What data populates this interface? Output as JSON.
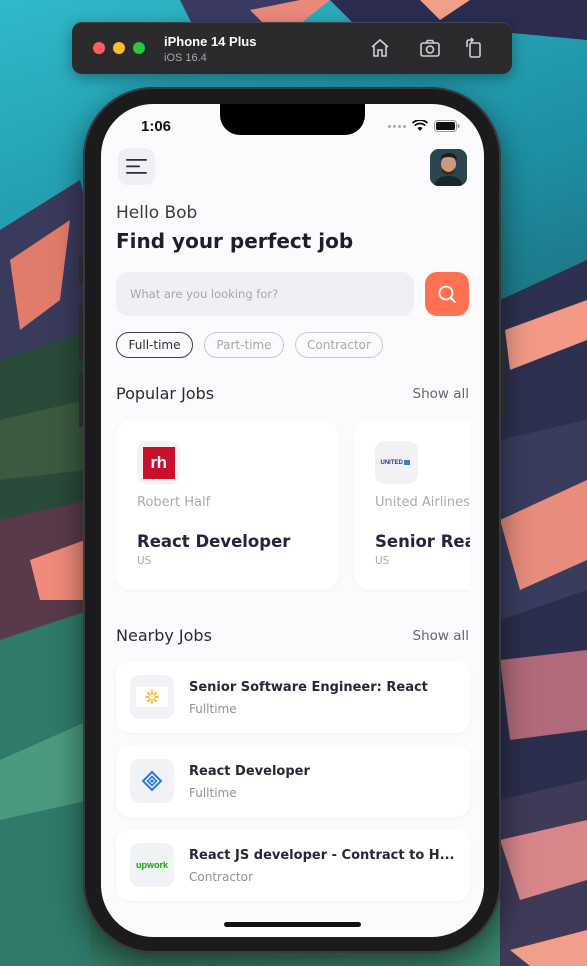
{
  "simulator": {
    "device": "iPhone 14 Plus",
    "os": "iOS 16.4"
  },
  "status_bar": {
    "time": "1:06"
  },
  "header": {
    "greeting": "Hello Bob",
    "headline": "Find your perfect job"
  },
  "search": {
    "placeholder": "What are you looking for?"
  },
  "filters": [
    {
      "label": "Full-time",
      "selected": true
    },
    {
      "label": "Part-time",
      "selected": false
    },
    {
      "label": "Contractor",
      "selected": false
    }
  ],
  "popular": {
    "title": "Popular Jobs",
    "show_all": "Show all",
    "cards": [
      {
        "logo": "rh",
        "company": "Robert Half",
        "role": "React Developer",
        "location": "US"
      },
      {
        "logo": "UNITED",
        "company": "United Airlines",
        "role": "Senior React Developer",
        "location": "US"
      }
    ]
  },
  "nearby": {
    "title": "Nearby Jobs",
    "show_all": "Show all",
    "items": [
      {
        "title": "Senior Software Engineer: React",
        "type": "Fulltime"
      },
      {
        "title": "React Developer",
        "type": "Fulltime"
      },
      {
        "title": "React JS developer - Contract to H...",
        "type": "Contractor",
        "logo": "upwork"
      }
    ]
  },
  "colors": {
    "accent": "#fe7251",
    "brand_rh": "#c8102e",
    "upwork": "#14a800"
  },
  "icons": {
    "menu": "menu-icon",
    "search": "search-icon",
    "home": "home-icon",
    "screenshot": "camera-icon",
    "rotate": "rotate-icon"
  }
}
